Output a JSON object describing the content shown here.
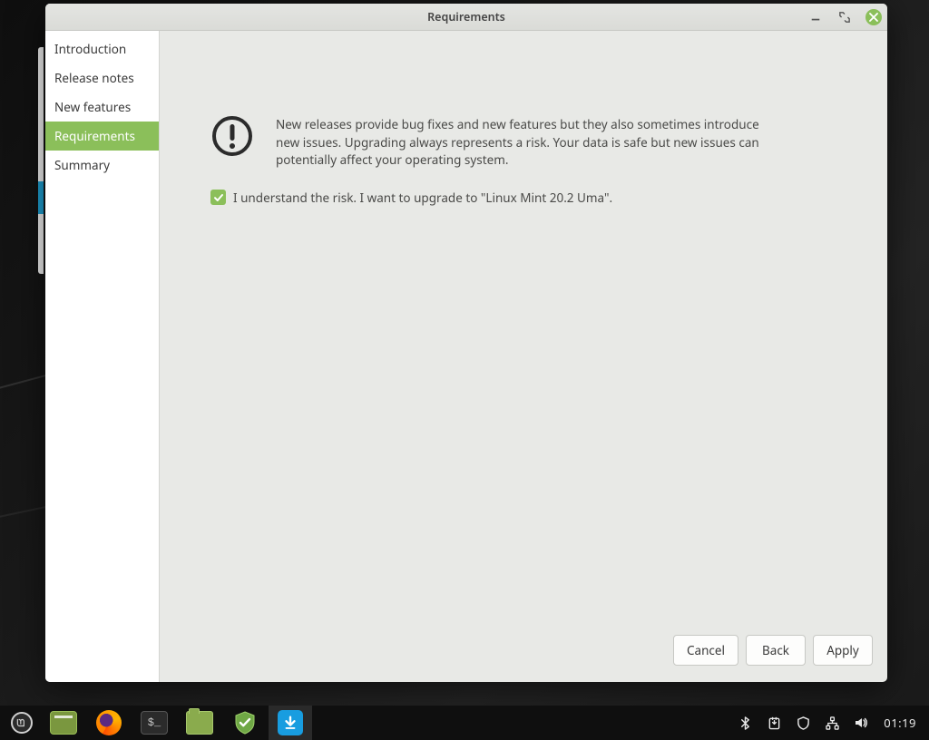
{
  "window": {
    "title": "Requirements"
  },
  "sidebar": {
    "items": [
      {
        "label": "Introduction"
      },
      {
        "label": "Release notes"
      },
      {
        "label": "New features"
      },
      {
        "label": "Requirements"
      },
      {
        "label": "Summary"
      }
    ],
    "active_index": 3
  },
  "content": {
    "warning_text": "New releases provide bug fixes and new features but they also sometimes introduce new issues. Upgrading always represents a risk. Your data is safe but new issues can potentially affect your operating system.",
    "consent_text": "I understand the risk. I want to upgrade to \"Linux Mint 20.2 Uma\".",
    "consent_checked": true
  },
  "buttons": {
    "cancel": "Cancel",
    "back": "Back",
    "apply": "Apply"
  },
  "taskbar": {
    "clock": "01:19"
  },
  "colors": {
    "accent": "#8bbf5a",
    "update_blue": "#189de0"
  }
}
